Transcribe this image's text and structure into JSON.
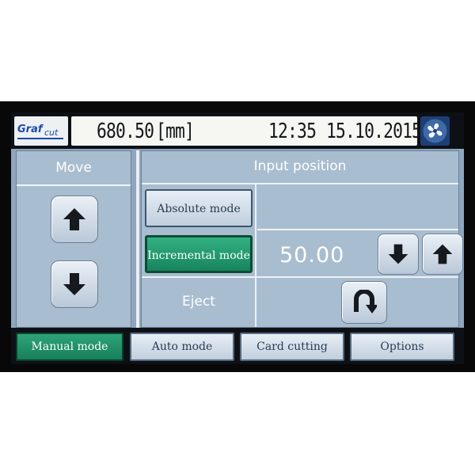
{
  "header": {
    "logo_brand": "Graf",
    "logo_suffix": "cut",
    "position_value": "680.50",
    "position_unit": "[mm]",
    "time": "12:35",
    "date": "15.10.2015"
  },
  "move_panel": {
    "title": "Move"
  },
  "input_panel": {
    "title": "Input position",
    "absolute_label": "Absolute mode",
    "incremental_label": "Incremental mode",
    "step_value": "50.00",
    "eject_label": "Eject"
  },
  "tabs": [
    {
      "label": "Manual mode",
      "active": true
    },
    {
      "label": "Auto mode",
      "active": false
    },
    {
      "label": "Card cutting",
      "active": false
    },
    {
      "label": "Options",
      "active": false
    }
  ],
  "colors": {
    "panel": "#a9bdd0",
    "active_green": "#1f9a6c",
    "frame": "#080808"
  },
  "icons": {
    "move_up": "arrow-up-icon",
    "move_down": "arrow-down-icon",
    "step_down": "arrow-down-icon",
    "step_up": "arrow-up-icon",
    "eject": "u-turn-arrow-icon",
    "settings": "fan-icon"
  }
}
